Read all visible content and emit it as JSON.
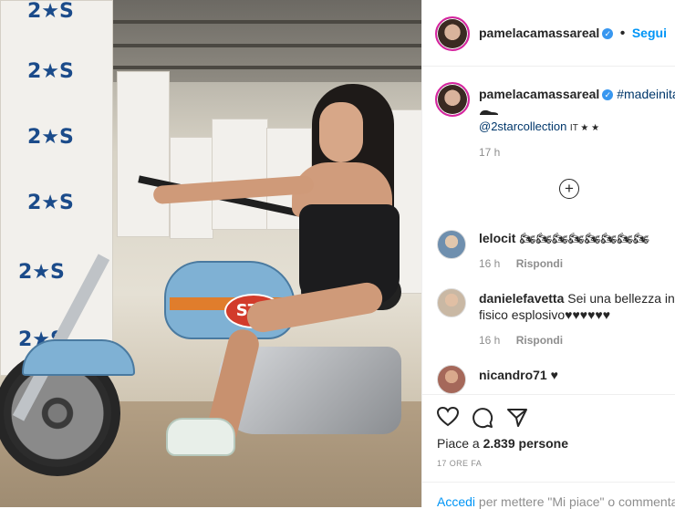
{
  "post": {
    "username": "pamelacamassareal",
    "follow_label": "Segui",
    "caption_hashtag": "#madeinitaly",
    "caption_mention": "@2starcollection",
    "caption_suffix": "IT ★ ★",
    "caption_time": "17 h",
    "photo_brand_text": "2★S",
    "photo_tank_text": "STP"
  },
  "comments": [
    {
      "user": "lelocit",
      "text": "🏍🏍🏍🏍🏍🏍🏍🏍",
      "time": "16 h",
      "reply": "Rispondi"
    },
    {
      "user": "danielefavetta",
      "text": "Sei una bellezza infin",
      "text2": "fisico esplosivo♥♥♥♥♥♥",
      "time": "16 h",
      "reply": "Rispondi"
    },
    {
      "user": "nicandro71",
      "text": "♥",
      "time": "",
      "reply": ""
    }
  ],
  "footer": {
    "likes_prefix": "Piace a ",
    "likes_count": "2.839",
    "likes_suffix": " persone",
    "timestamp": "17 ORE FA",
    "login_link": "Accedi",
    "login_rest": " per mettere \"Mi piace\" o commentar"
  },
  "colors": {
    "accent": "#0095f6",
    "verified": "#3897f0"
  }
}
